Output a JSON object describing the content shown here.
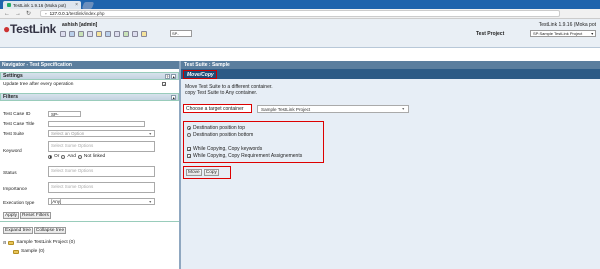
{
  "browser": {
    "tab_title": "TestLink 1.9.16 (Moka pot)",
    "url_host": "127.0.0.1",
    "url_path": "/testlink/index.php"
  },
  "header": {
    "logo_text": "TestLink",
    "user": "ashish [admin]",
    "version": "TestLink 1.9.16 (Moka pot",
    "search_value": "SP-",
    "test_project_label": "Test Project",
    "test_project_value": "SP:Sample TestLink Project"
  },
  "navigator": {
    "title": "Navigator - Test Specification",
    "settings": {
      "title": "Settings",
      "update_tree_label": "Update tree after every operation",
      "update_tree_checked": true
    },
    "filters": {
      "title": "Filters",
      "test_case_id_label": "Test Case ID",
      "test_case_id_value": "SP-",
      "test_case_title_label": "Test Case Title",
      "test_suite_label": "Test Suite",
      "test_suite_placeholder": "Select an Option",
      "keyword_label": "Keyword",
      "keyword_placeholder": "Select Some Options",
      "or_label": "Or",
      "and_label": "And",
      "not_linked_label": "Not linked",
      "status_label": "Status",
      "status_placeholder": "Select Some Options",
      "importance_label": "Importance",
      "importance_placeholder": "Select Some Options",
      "execution_type_label": "Execution type",
      "execution_type_value": "[Any]",
      "apply_button": "Apply",
      "reset_button": "Reset Filters"
    },
    "tree": {
      "expand_button": "Expand tree",
      "collapse_button": "Collapse tree",
      "root": "Sample TestLink Project (0)",
      "child": "Sample (0)"
    }
  },
  "main": {
    "title": "Test Suite : Sample",
    "tab_label": "Move/Copy",
    "desc_line1": "Move Test Suite to a different container.",
    "desc_line2": "copy Test Suite to Any container.",
    "choose_label": "Choose a target container",
    "container_value": "Sample TestLink Project",
    "options": {
      "dest_top": "Destination position top",
      "dest_bottom": "Destination position bottom",
      "copy_keywords": "While Copying, Copy keywords",
      "copy_requirements": "While Copying, Copy Requirement Assignements"
    },
    "move_button": "Move",
    "copy_button": "Copy"
  },
  "colors": {
    "highlight_border": "#dd0000",
    "nav_bar": "#5b7e9e",
    "tab_bar": "#2d5b86"
  }
}
